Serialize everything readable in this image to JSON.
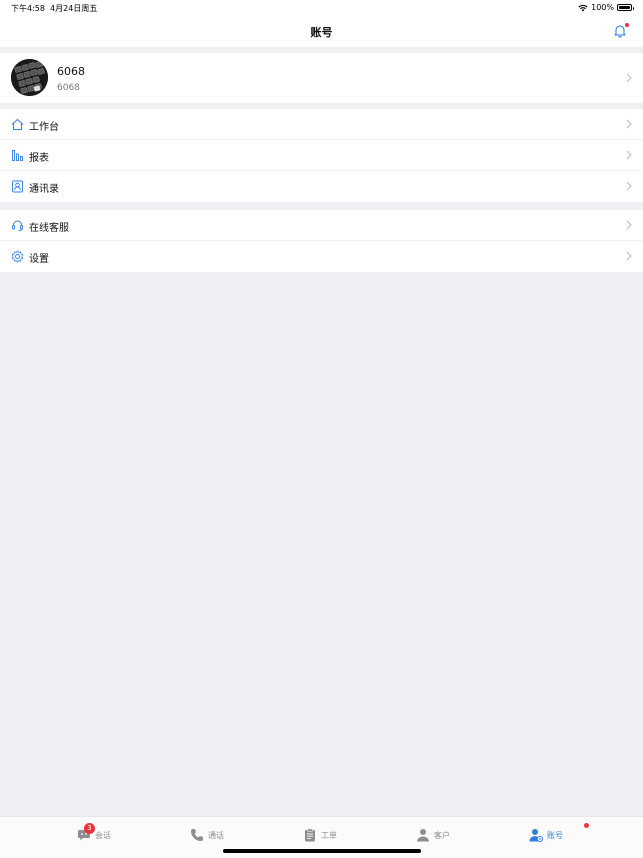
{
  "status_bar": {
    "time": "下午4:58",
    "date": "4月24日周五",
    "battery": "100%"
  },
  "navbar": {
    "title": "账号"
  },
  "profile": {
    "name": "6068",
    "subtitle": "6068"
  },
  "menu_group_1": [
    {
      "label": "工作台",
      "icon": "home-icon"
    },
    {
      "label": "报表",
      "icon": "chart-icon"
    },
    {
      "label": "通讯录",
      "icon": "contacts-icon"
    }
  ],
  "menu_group_2": [
    {
      "label": "在线客服",
      "icon": "headset-icon"
    },
    {
      "label": "设置",
      "icon": "gear-icon"
    }
  ],
  "tabbar": {
    "items": [
      {
        "label": "会话",
        "icon": "chat-icon",
        "badge": "3"
      },
      {
        "label": "通话",
        "icon": "phone-icon"
      },
      {
        "label": "工单",
        "icon": "clipboard-icon"
      },
      {
        "label": "客户",
        "icon": "person-icon"
      },
      {
        "label": "账号",
        "icon": "account-icon",
        "active": true
      }
    ]
  },
  "colors": {
    "accent": "#2f7ee0",
    "badge": "#f0333b",
    "background": "#efeff4"
  }
}
